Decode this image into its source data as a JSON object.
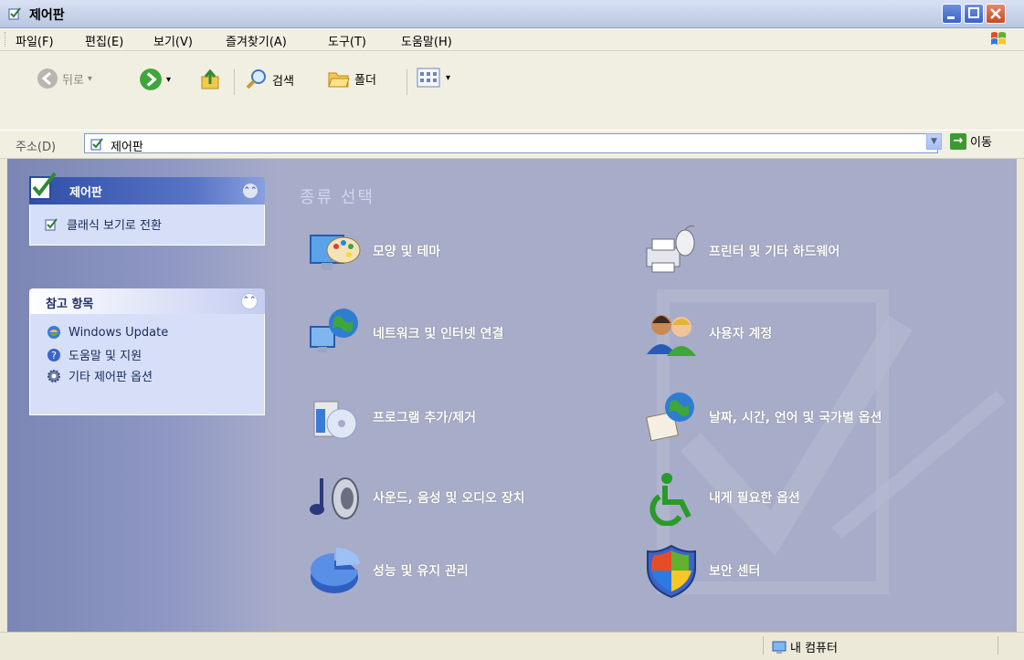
{
  "window": {
    "title": "제어판"
  },
  "menu": [
    "파일(F)",
    "편집(E)",
    "보기(V)",
    "즐겨찾기(A)",
    "도구(T)",
    "도움말(H)"
  ],
  "toolbar": {
    "back": "뒤로",
    "search": "검색",
    "folders": "폴더"
  },
  "address": {
    "label": "주소(D)",
    "value": "제어판",
    "go": "이동"
  },
  "sidebar": {
    "panel_title": "제어판",
    "panel_link": "클래식 보기로 전환",
    "see_also_title": "참고 항목",
    "see_also": [
      "Windows Update",
      "도움말 및 지원",
      "기타 제어판 옵션"
    ]
  },
  "main": {
    "pick": "종류 선택",
    "categories": [
      "모양 및 테마",
      "프린터 및 기타 하드웨어",
      "네트워크 및 인터넷 연결",
      "사용자 계정",
      "프로그램 추가/제거",
      "날짜, 시간, 언어 및 국가별 옵션",
      "사운드, 음성 및 오디오 장치",
      "내게 필요한 옵션",
      "성능 및 유지 관리",
      "보안 센터"
    ]
  },
  "status": {
    "zone": "내 컴퓨터"
  }
}
